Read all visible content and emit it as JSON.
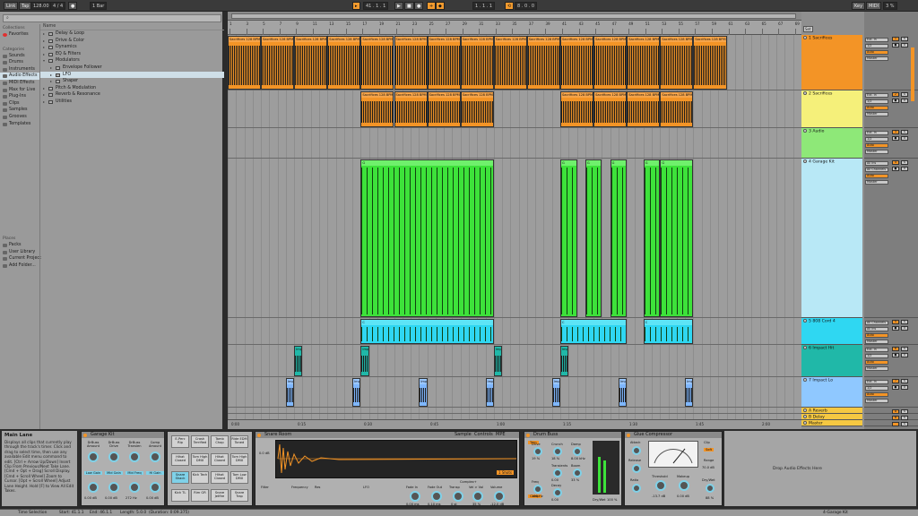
{
  "topbar": {
    "link": "Link",
    "tap": "Tap",
    "tempo": "128.00",
    "sig": "4 / 4",
    "metro": "●",
    "quant": "1 Bar",
    "position": "41 .  1 .  1",
    "loop_start": "1 .  1 .  1",
    "loop_len": "8 .  0 .  0",
    "key": "Key",
    "midi": "MIDI",
    "cpu": "3 %"
  },
  "browser": {
    "search_placeholder": "Search",
    "collections_header": "Collections",
    "favorites": "Favorites",
    "categories_header": "Categories",
    "categories": [
      "Sounds",
      "Drums",
      "Instruments",
      "Audio Effects",
      "MIDI Effects",
      "Max for Live",
      "Plug-Ins",
      "Clips",
      "Samples",
      "Grooves",
      "Templates"
    ],
    "places_header": "Places",
    "places": [
      "Packs",
      "User Library",
      "Current Project",
      "Add Folder..."
    ],
    "name_header": "Name",
    "folders": [
      {
        "label": "Delay & Loop",
        "level": 0,
        "open": false
      },
      {
        "label": "Drive & Color",
        "level": 0,
        "open": false
      },
      {
        "label": "Dynamics",
        "level": 0,
        "open": false
      },
      {
        "label": "EQ & Filters",
        "level": 0,
        "open": false
      },
      {
        "label": "Modulators",
        "level": 0,
        "open": true
      },
      {
        "label": "Envelope Follower",
        "level": 1,
        "open": false
      },
      {
        "label": "LFO",
        "level": 1,
        "open": false,
        "selected": true
      },
      {
        "label": "Shaper",
        "level": 1,
        "open": false
      },
      {
        "label": "Pitch & Modulation",
        "level": 0,
        "open": false
      },
      {
        "label": "Reverb & Resonance",
        "level": 0,
        "open": false
      },
      {
        "label": "Utilities",
        "level": 0,
        "open": false
      }
    ]
  },
  "ruler": {
    "bars": [
      "1",
      "3",
      "5",
      "7",
      "9",
      "11",
      "13",
      "15",
      "17",
      "19",
      "21",
      "23",
      "25",
      "27",
      "29",
      "31",
      "33",
      "35",
      "37",
      "39",
      "41",
      "43",
      "45",
      "47",
      "49",
      "51",
      "53",
      "55",
      "57",
      "59",
      "61",
      "63",
      "65",
      "67",
      "69"
    ],
    "times": [
      "0:00",
      "0:15",
      "0:30",
      "0:45",
      "1:00",
      "1:15",
      "1:30",
      "1:45",
      "2:00",
      "2:15"
    ]
  },
  "tracks": [
    {
      "name": "1 Sacrifices",
      "color": "#f39426",
      "input": "Ext. In",
      "chan": "1/2",
      "mon_auto": "Auto",
      "out": "Master",
      "num": "1"
    },
    {
      "name": "2 Sacrifices",
      "color": "#f5f07a",
      "input": "Ext. In",
      "chan": "1/2",
      "mon_auto": "Auto",
      "out": "Master",
      "num": "2"
    },
    {
      "name": "3 Audio",
      "color": "#8ee878",
      "input": "Ext. In",
      "chan": "1/2",
      "mon_auto": "Auto",
      "out": "Master",
      "num": "3"
    },
    {
      "name": "4 Garage Kit",
      "color": "#b8e8f6",
      "input": "All Ins",
      "chan": "All Channels",
      "mon_auto": "Auto",
      "out": "Master",
      "num": "4"
    },
    {
      "name": "5 808 Cord 4",
      "color": "#2fd7f2",
      "input": "All Channels",
      "chan": "All Ins",
      "mon_auto": "Auto",
      "out": "Master",
      "num": "5"
    },
    {
      "name": "6 Impact Hit",
      "color": "#20b8a8",
      "input": "Ext. In",
      "chan": "1/2",
      "mon_auto": "Auto",
      "out": "Master",
      "num": "6"
    },
    {
      "name": "7 Impact Lo",
      "color": "#8fc8ff",
      "input": "Ext. In",
      "chan": "1/2",
      "mon_auto": "Auto",
      "out": "Master",
      "num": "7"
    },
    {
      "name": "A Reverb",
      "color": "#f5c842",
      "num": "A"
    },
    {
      "name": "B Delay",
      "color": "#f5c842",
      "num": "B"
    },
    {
      "name": "Master",
      "color": "#f5c842",
      "num": ""
    }
  ],
  "clips": {
    "sacrifices_label": "Sacrifices 128 BPM Bsm @april4th",
    "garage_label": "G",
    "cord_label": "C",
    "impact_hit_label": "Imp",
    "impact_lo_label": "Imp"
  },
  "info": {
    "title": "Main Lane",
    "text": "Displays all clips that currently play through the track's timer. Click and drag to select time, then use any available Edit menu command to edit. [Ctrl + Arrow Up/Down] Insert Clip From Previous/Next Take Lane. [Cmd + Opt + Drag] Scroll Display. [Cmd + Scroll Wheel] Zoom to Cursor. [Opt + Scroll Wheel] Adjust Lane Height. Hold [F] to View All Edit Takes."
  },
  "devices": {
    "garage_kit": {
      "title": "Garage Kit",
      "macros": [
        "DrBuss Amount",
        "DrBuss Drive",
        "DrBuss Transien",
        "Comp Amount",
        "Low Gain",
        "Mid Gain",
        "Mid Freq",
        "Hi Gain"
      ],
      "macro_values": [
        "0.00 dB",
        "0.00 dB",
        "272 Hz",
        "0.00 dB"
      ],
      "pads": [
        "E-Perc Rip",
        "Crash Terrified",
        "Tamb Chop",
        "Ride EDM Toned",
        "Hihat Closed",
        "Tom High DMX",
        "Hihat Closed",
        "Tom High DMX",
        "Snare Shack",
        "Kick Tech",
        "Hihat Closed",
        "Tom Low DMX",
        "Kick TL",
        "Rim GR",
        "Snare Jetfire",
        "Snare Trap"
      ]
    },
    "snare_room": {
      "title": "Snare Room",
      "sample": "Sample",
      "controls": "Controls",
      "mpe": "MPE",
      "gain": "0.0 dB",
      "filter": "Filter",
      "freq_label": "Frequency",
      "res_label": "Res",
      "lfo": "LFO",
      "fade_in": "Fade In",
      "fade_out": "Fade Out",
      "transp": "Transp",
      "vel_vol": "Vel > Vol",
      "volume": "Volume",
      "fade_in_val": "0.00 ms",
      "fade_out_val": "0.10 ms",
      "transp_val": "0 st",
      "vel_vol_val": "35 %",
      "volume_val": "-12.0 dB",
      "mode": "1 Shots",
      "complex": "Complex+"
    },
    "drum_buss": {
      "title": "Drum Buss",
      "knobs": [
        "Drive",
        "Crunch",
        "Damp",
        "Transients",
        "Boom",
        "Freq",
        "Decay"
      ],
      "values": [
        "19 %",
        "18 %",
        "8.00 kHz",
        "0.00",
        "33 %",
        "100 Hz",
        "0.00"
      ],
      "drymix": "Dry/Wet",
      "drymix_val": "100 %",
      "trim": "Trim",
      "comp": "Comp"
    },
    "glue_comp": {
      "title": "Glue Compressor",
      "attack": "Attack",
      "release": "Release",
      "ratio": "Ratio",
      "threshold": "Threshold",
      "threshold_val": "-13.7 dB",
      "makeup": "Makeup",
      "makeup_val": "0.00 dB",
      "range": "Range",
      "range_val": "70.0 dB",
      "drywet": "Dry/Wet",
      "drywet_val": "88 %",
      "clip": "Clip",
      "soft": "Soft"
    },
    "drop_hint": "Drop Audio Effects Here"
  },
  "status": {
    "selection": "Time Selection",
    "start": "Start: 41.1.1",
    "end": "End: 46.1.1",
    "length": "Length: 5.0.0",
    "duration": "(Duration: 0:09.375)",
    "right": "4-Garage Kit"
  }
}
